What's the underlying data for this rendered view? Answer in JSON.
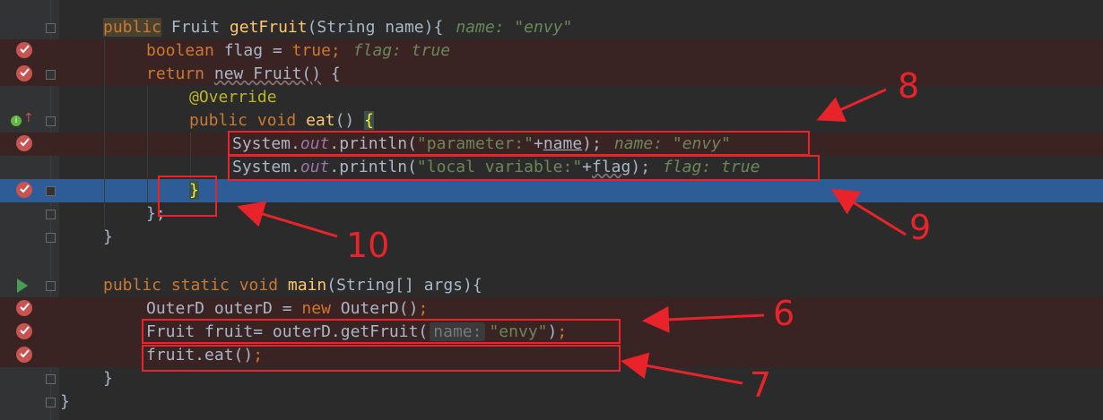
{
  "editor": {
    "lines": [
      {
        "id": "l1",
        "bg": "none"
      },
      {
        "id": "l2",
        "bg": "bp"
      },
      {
        "id": "l3",
        "bg": "bp"
      }
    ],
    "code": {
      "l1_kw": "public",
      "l1_rest_a": " Fruit ",
      "l1_fn": "getFruit",
      "l1_rest_b": "(String name){",
      "l1_hint": "name: \"envy\"",
      "l2_kw": "boolean",
      "l2_rest": " flag = ",
      "l2_true": "true",
      "l2_semi": ";",
      "l2_hint": "flag: true",
      "l3_kw": "return",
      "l3_new": "new Fruit()",
      "l3_rest": " {",
      "l4_ann": "@Override",
      "l5_kw": "public void",
      "l5_fn": "eat",
      "l5_rest": "() ",
      "l5_brace": "{",
      "l6_a": "System.",
      "l6_out": "out",
      "l6_b": ".println(",
      "l6_str": "\"parameter:\"",
      "l6_c": "+",
      "l6_var": "name",
      "l6_d": ");",
      "l6_hint": "name: \"envy\"",
      "l7_a": "System.",
      "l7_out": "out",
      "l7_b": ".println(",
      "l7_str": "\"local variable:\"",
      "l7_c": "+",
      "l7_var": "flag",
      "l7_d": ");",
      "l7_hint": "flag: true",
      "l8_brace": "}",
      "l9": "};",
      "l10": "}",
      "l12_kw": "public static void",
      "l12_fn": "main",
      "l12_rest": "(String[] args){",
      "l13_a": "OuterD outerD = ",
      "l13_kw": "new",
      "l13_b": " OuterD()",
      "l13_semi": ";",
      "l14_a": "Fruit fruit= outerD.getFruit(",
      "l14_hint": "name:",
      "l14_str": "\"envy\"",
      "l14_b": ")",
      "l14_semi": ";",
      "l15_a": "fruit.eat()",
      "l15_semi": ";",
      "l16": "}",
      "l17": "}"
    }
  },
  "annotations": {
    "n8": "8",
    "n9": "9",
    "n10": "10",
    "n6": "6",
    "n7": "7"
  },
  "colors": {
    "accent_red": "#e8232a",
    "current_line": "#2d5c97",
    "breakpoint_line": "#3a2323"
  }
}
